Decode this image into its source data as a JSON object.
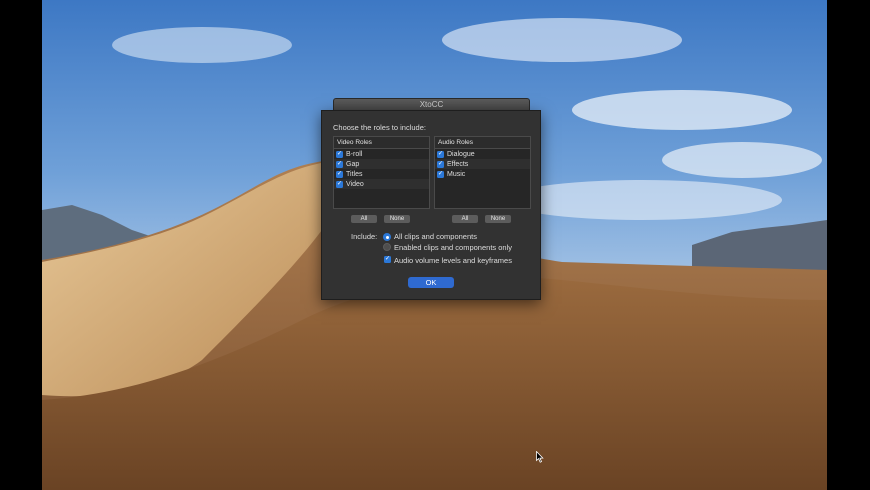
{
  "window": {
    "title": "XtoCC"
  },
  "dialog": {
    "prompt": "Choose the roles to include:",
    "video_roles": {
      "header": "Video Roles",
      "items": [
        {
          "label": "B-roll",
          "checked": true
        },
        {
          "label": "Gap",
          "checked": true
        },
        {
          "label": "Titles",
          "checked": true
        },
        {
          "label": "Video",
          "checked": true
        }
      ],
      "all_label": "All",
      "none_label": "None"
    },
    "audio_roles": {
      "header": "Audio Roles",
      "items": [
        {
          "label": "Dialogue",
          "checked": true
        },
        {
          "label": "Effects",
          "checked": true
        },
        {
          "label": "Music",
          "checked": true
        }
      ],
      "all_label": "All",
      "none_label": "None"
    },
    "include_label": "Include:",
    "include_options": [
      {
        "label": "All clips and components",
        "selected": true
      },
      {
        "label": "Enabled clips and components only",
        "selected": false
      }
    ],
    "audio_levels": {
      "label": "Audio volume levels and keyframes",
      "checked": true
    },
    "ok_label": "OK"
  },
  "colors": {
    "accent": "#2b78d8",
    "ok_button": "#2f6ad0",
    "dialog_bg": "#323232"
  },
  "icons": {
    "checkmark": "checkmark-icon",
    "cursor": "mouse-pointer-icon"
  }
}
